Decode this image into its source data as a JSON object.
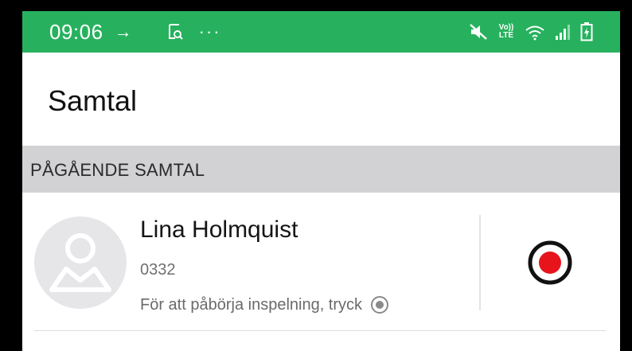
{
  "status_bar": {
    "time": "09:06",
    "arrow_glyph": "→",
    "more_glyph": "···",
    "volte_top": "Vo))",
    "volte_bottom": "LTE",
    "icons": [
      "forward-arrow-icon",
      "screenshot-icon",
      "more-icon",
      "mute-icon",
      "volte-icon",
      "wifi-icon",
      "signal-icon",
      "battery-icon"
    ],
    "background": "#27b15e"
  },
  "header": {
    "title": "Samtal"
  },
  "section": {
    "title": "PÅGÅENDE SAMTAL",
    "background": "#d2d1d3"
  },
  "call": {
    "name": "Lina Holmquist",
    "number": "0332",
    "hint": "För att påbörja inspelning, tryck",
    "record_color": "#e8141b"
  }
}
